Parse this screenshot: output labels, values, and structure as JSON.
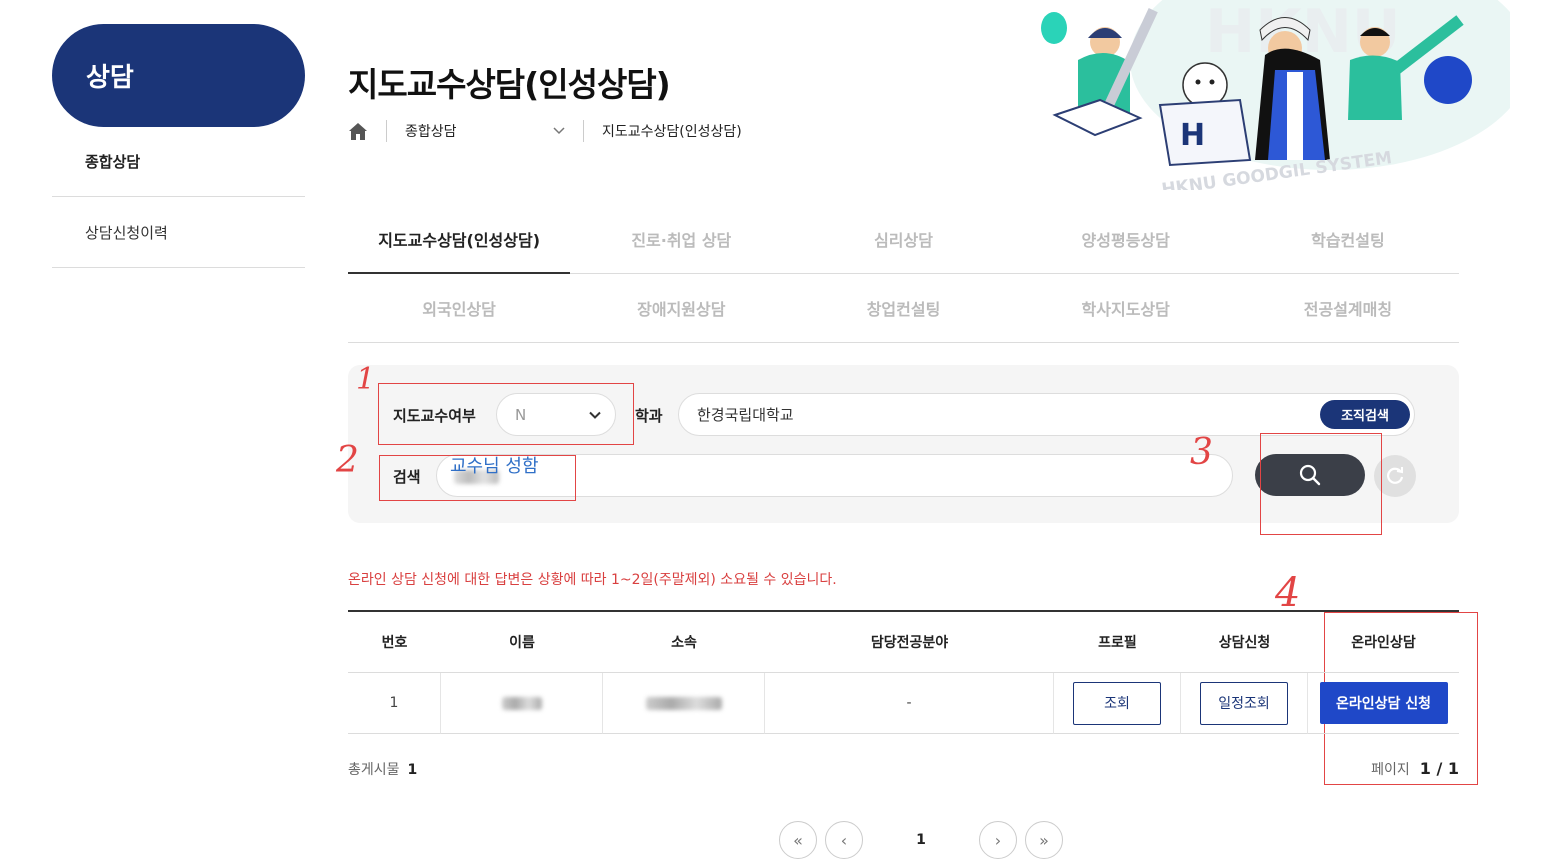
{
  "sidebar": {
    "title": "상담",
    "items": [
      {
        "label": "종합상담"
      },
      {
        "label": "상담신청이력"
      }
    ]
  },
  "header": {
    "title": "지도교수상담(인성상담)",
    "breadcrumb": {
      "level1": "종합상담",
      "level2": "지도교수상담(인성상담)"
    }
  },
  "illustration": {
    "watermark": "HKNU",
    "caption": "HKNU GOODGIL SYSTEM"
  },
  "tabs": {
    "row1": [
      "지도교수상담(인성상담)",
      "진로·취업 상담",
      "심리상담",
      "양성평등상담",
      "학습컨설팅"
    ],
    "row2": [
      "외국인상담",
      "장애지원상담",
      "창업컨설팅",
      "학사지도상담",
      "전공설계매칭"
    ],
    "active": "지도교수상담(인성상담)"
  },
  "search": {
    "advisor_label": "지도교수여부",
    "advisor_value": "N",
    "dept_label": "학과",
    "dept_value": "한경국립대학교",
    "org_search_label": "조직검색",
    "keyword_label": "검색"
  },
  "annotations": {
    "n1": "1",
    "n2": "2",
    "n3": "3",
    "n4": "4",
    "hint": "교수님 성함"
  },
  "notice": "온라인 상담 신청에 대한 답변은 상황에 따라 1~2일(주말제외) 소요될 수 있습니다.",
  "table": {
    "headers": [
      "번호",
      "이름",
      "소속",
      "담당전공분야",
      "프로필",
      "상담신청",
      "온라인상담"
    ],
    "rows": [
      {
        "no": "1",
        "field": "-",
        "profile_btn": "조회",
        "schedule_btn": "일정조회",
        "online_btn": "온라인상담 신청"
      }
    ]
  },
  "footer": {
    "total_label": "총게시물",
    "total_value": "1",
    "page_label": "페이지",
    "page_value": "1 / 1"
  },
  "pagination": {
    "first": "«",
    "prev": "‹",
    "current": "1",
    "next": "›",
    "last": "»"
  },
  "colors": {
    "primary_navy": "#1b3578",
    "primary_blue": "#1f48c8",
    "notice_red": "#d94040",
    "annotation_red": "#e24545"
  }
}
